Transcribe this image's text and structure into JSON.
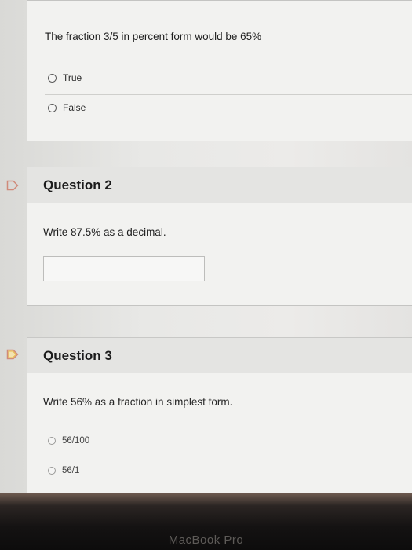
{
  "question1": {
    "text": "The fraction 3/5 in percent form would be 65%",
    "options": [
      {
        "label": "True",
        "selected": false
      },
      {
        "label": "False",
        "selected": false
      }
    ]
  },
  "question2": {
    "title": "Question 2",
    "text": "Write 87.5% as a decimal.",
    "answer_value": ""
  },
  "question3": {
    "title": "Question 3",
    "text": "Write 56% as a fraction in simplest form.",
    "options": [
      {
        "label": "56/100",
        "selected": false
      },
      {
        "label": "56/1",
        "selected": false
      }
    ]
  },
  "device": {
    "brand_label": "MacBook Pro"
  },
  "colors": {
    "flag_outline": "#d08a7a",
    "flag_accent": "#e8b84a"
  }
}
